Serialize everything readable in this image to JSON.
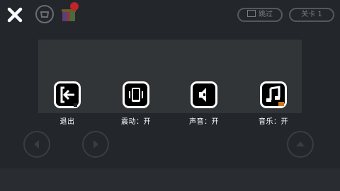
{
  "topbar": {
    "close_icon": "close-icon",
    "bag_icon": "shopping-bag-icon",
    "gift_icon": "gift-icon",
    "skip_label": "跳过",
    "level_label": "关卡 1"
  },
  "menu": {
    "items": [
      {
        "id": "exit",
        "icon": "exit-icon",
        "label": "退出"
      },
      {
        "id": "vibration",
        "icon": "vibration-icon",
        "label": "震动：开"
      },
      {
        "id": "sound",
        "icon": "speaker-icon",
        "label": "声音：开"
      },
      {
        "id": "music",
        "icon": "music-note-icon",
        "label": "音乐：开"
      }
    ]
  },
  "controls": {
    "left_icon": "arrow-left-icon",
    "right_icon": "arrow-right-icon",
    "up_icon": "arrow-up-icon"
  },
  "colors": {
    "background": "#23262b",
    "panel": "#323538",
    "icon": "#ffffff",
    "accent_red": "#c0242c",
    "music_accent": "#c8781e"
  }
}
